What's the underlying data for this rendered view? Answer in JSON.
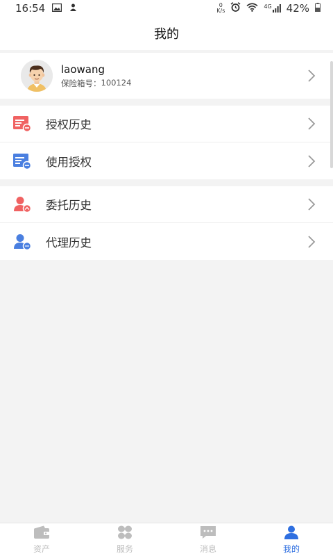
{
  "status_bar": {
    "time": "16:54",
    "net_speed_top": "0",
    "net_speed_unit": "K/s",
    "network_type": "4G",
    "battery": "42%"
  },
  "header": {
    "title": "我的"
  },
  "profile": {
    "username": "laowang",
    "policy_label": "保险箱号：",
    "policy_number": "100124"
  },
  "menu_group_1": [
    {
      "label": "授权历史",
      "icon": "auth-history-icon",
      "color": "#f06262"
    },
    {
      "label": "使用授权",
      "icon": "use-auth-icon",
      "color": "#4a7fe0"
    }
  ],
  "menu_group_2": [
    {
      "label": "委托历史",
      "icon": "entrust-history-icon",
      "color": "#f06262"
    },
    {
      "label": "代理历史",
      "icon": "agent-history-icon",
      "color": "#4a7fe0"
    }
  ],
  "tabbar": {
    "tabs": [
      {
        "label": "资产",
        "icon": "wallet-icon"
      },
      {
        "label": "服务",
        "icon": "grid-icon"
      },
      {
        "label": "消息",
        "icon": "message-icon"
      },
      {
        "label": "我的",
        "icon": "user-icon"
      }
    ],
    "active": "我的",
    "active_color": "#2f6fe0",
    "inactive_color": "#bdbdbd"
  }
}
